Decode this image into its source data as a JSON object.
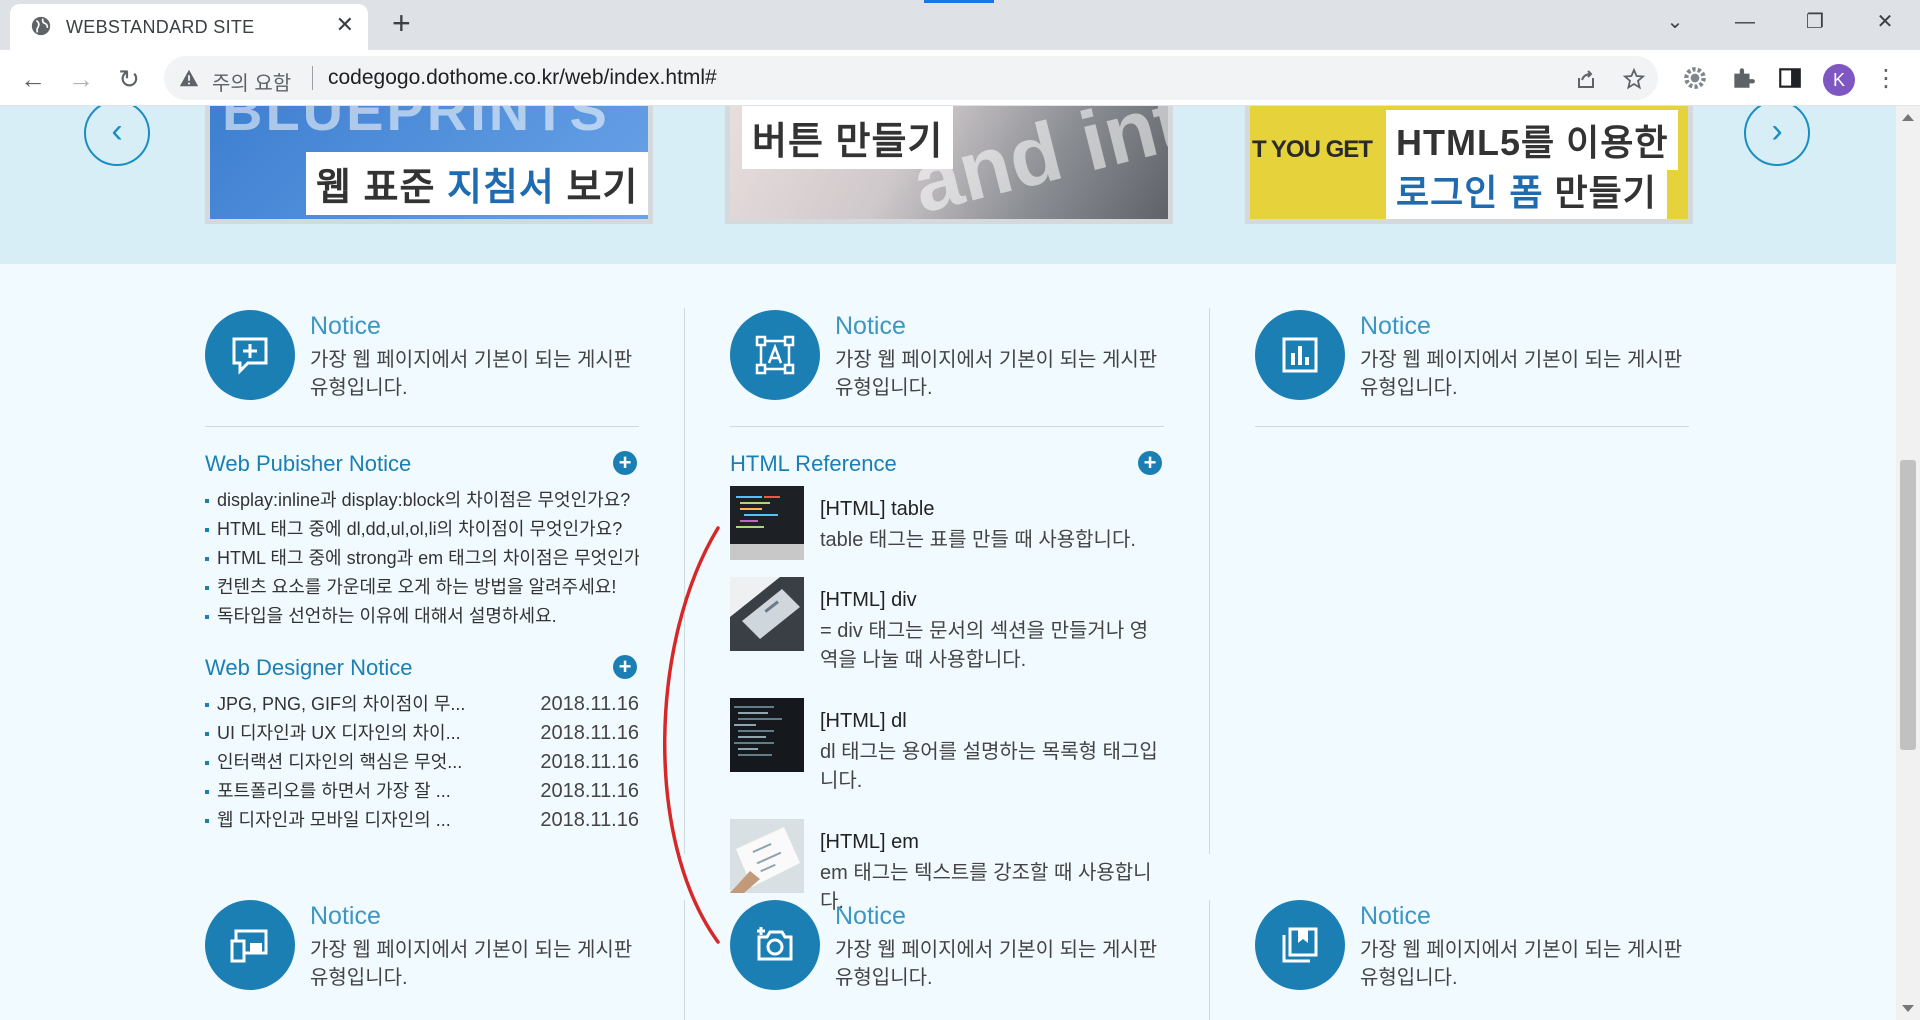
{
  "browser": {
    "tab_title": "WEBSTANDARD SITE",
    "new_tab": "+",
    "security_label": "주의 요함",
    "url": "codegogo.dothome.co.kr/web/index.html#",
    "avatar_initial": "K"
  },
  "slider": {
    "banners": [
      {
        "text_a": "웹 표준 ",
        "text_b": "지침서",
        "text_c": " 보기",
        "deco": "BLUEPRINTS"
      },
      {
        "text_a": "버튼 만들기",
        "deco": "and inte"
      },
      {
        "deco": "T YOU GET",
        "line1": "HTML5를 이용한",
        "line2_a": "로그인 폼",
        "line2_b": " 만들기"
      }
    ]
  },
  "features_top": [
    {
      "title": "Notice",
      "desc": "가장 웹 페이지에서 기본이 되는 게시판 유형입니다.",
      "icon": "message-plus-icon"
    },
    {
      "title": "Notice",
      "desc": "가장 웹 페이지에서 기본이 되는 게시판 유형입니다.",
      "icon": "text-frame-icon"
    },
    {
      "title": "Notice",
      "desc": "가장 웹 페이지에서 기본이 되는 게시판 유형입니다.",
      "icon": "bar-chart-icon"
    }
  ],
  "features_bottom": [
    {
      "title": "Notice",
      "desc": "가장 웹 페이지에서 기본이 되는 게시판 유형입니다.",
      "icon": "devices-icon"
    },
    {
      "title": "Notice",
      "desc": "가장 웹 페이지에서 기본이 되는 게시판 유형입니다.",
      "icon": "camera-plus-icon"
    },
    {
      "title": "Notice",
      "desc": "가장 웹 페이지에서 기본이 되는 게시판 유형입니다.",
      "icon": "bookmark-stack-icon"
    }
  ],
  "publisher_notice": {
    "title": "Web Pubisher Notice",
    "items": [
      "display:inline과 display:block의 차이점은 무엇인가요?",
      "HTML 태그 중에 dl,dd,ul,ol,li의 차이점이 무엇인가요?",
      "HTML 태그 중에 strong과 em 태그의 차이점은 무엇인가요?",
      "컨텐츠 요소를 가운데로 오게 하는 방법을 알려주세요!",
      "독타입을 선언하는 이유에 대해서 설명하세요."
    ]
  },
  "designer_notice": {
    "title": "Web Designer Notice",
    "items": [
      {
        "text": "JPG, PNG, GIF의 차이점이 무...",
        "date": "2018.11.16"
      },
      {
        "text": "UI 디자인과 UX 디자인의 차이...",
        "date": "2018.11.16"
      },
      {
        "text": "인터랙션 디자인의 핵심은 무엇...",
        "date": "2018.11.16"
      },
      {
        "text": "포트폴리오를 하면서 가장 잘 ...",
        "date": "2018.11.16"
      },
      {
        "text": "웹 디자인과 모바일 디자인의 ...",
        "date": "2018.11.16"
      }
    ]
  },
  "html_reference": {
    "title": "HTML Reference",
    "items": [
      {
        "title": "[HTML] table",
        "desc": "table 태그는 표를 만들 때 사용합니다."
      },
      {
        "title": "[HTML] div",
        "desc": "= div 태그는 문서의 섹션을 만들거나 영역을 나눌 때 사용합니다."
      },
      {
        "title": "[HTML] dl",
        "desc": "dl 태그는 용어를 설명하는 목록형 태그입니다."
      },
      {
        "title": "[HTML] em",
        "desc": "em 태그는 텍스트를 강조할 때 사용합니다."
      }
    ]
  },
  "colors": {
    "accent": "#1b7fb4",
    "band": "#d8eef6",
    "page": "#f1fbff",
    "annotation": "#d62828"
  }
}
